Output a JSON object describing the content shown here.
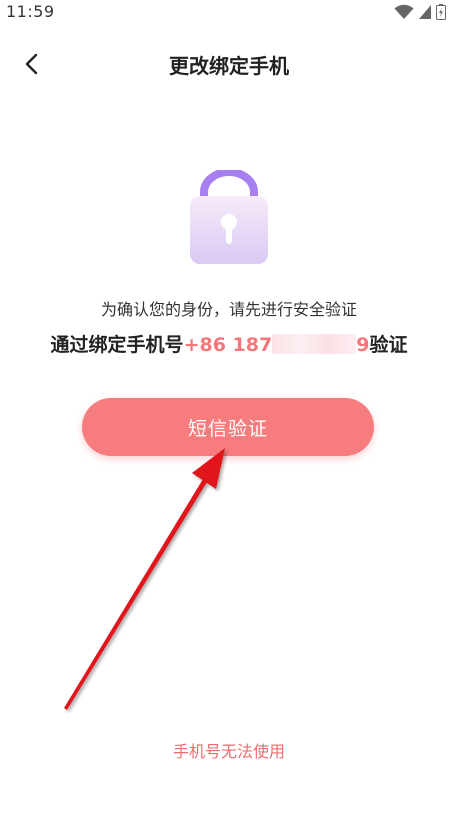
{
  "status_bar": {
    "time": "11:59",
    "icons": [
      "wifi-icon",
      "signal-icon",
      "battery-icon"
    ]
  },
  "header": {
    "title": "更改绑定手机",
    "back_icon": "chevron-left-icon"
  },
  "lock": {
    "icon": "lock-icon",
    "colors": {
      "shackle": "#a77ff0",
      "body_top": "#f6ecf9",
      "body_bottom": "#d9c9f4",
      "keyhole": "#ffffff"
    }
  },
  "verify": {
    "confirm_text": "为确认您的身份，请先进行安全验证",
    "prefix": "通过绑定手机号",
    "phone_visible_start": "+86 187",
    "phone_visible_end": "9",
    "suffix": "验证"
  },
  "sms_button": {
    "label": "短信验证"
  },
  "footer": {
    "link_label": "手机号无法使用"
  },
  "colors": {
    "accent": "#f67c7e",
    "accent_text": "#ee6b6f",
    "annotation_arrow": "#e0151b"
  }
}
